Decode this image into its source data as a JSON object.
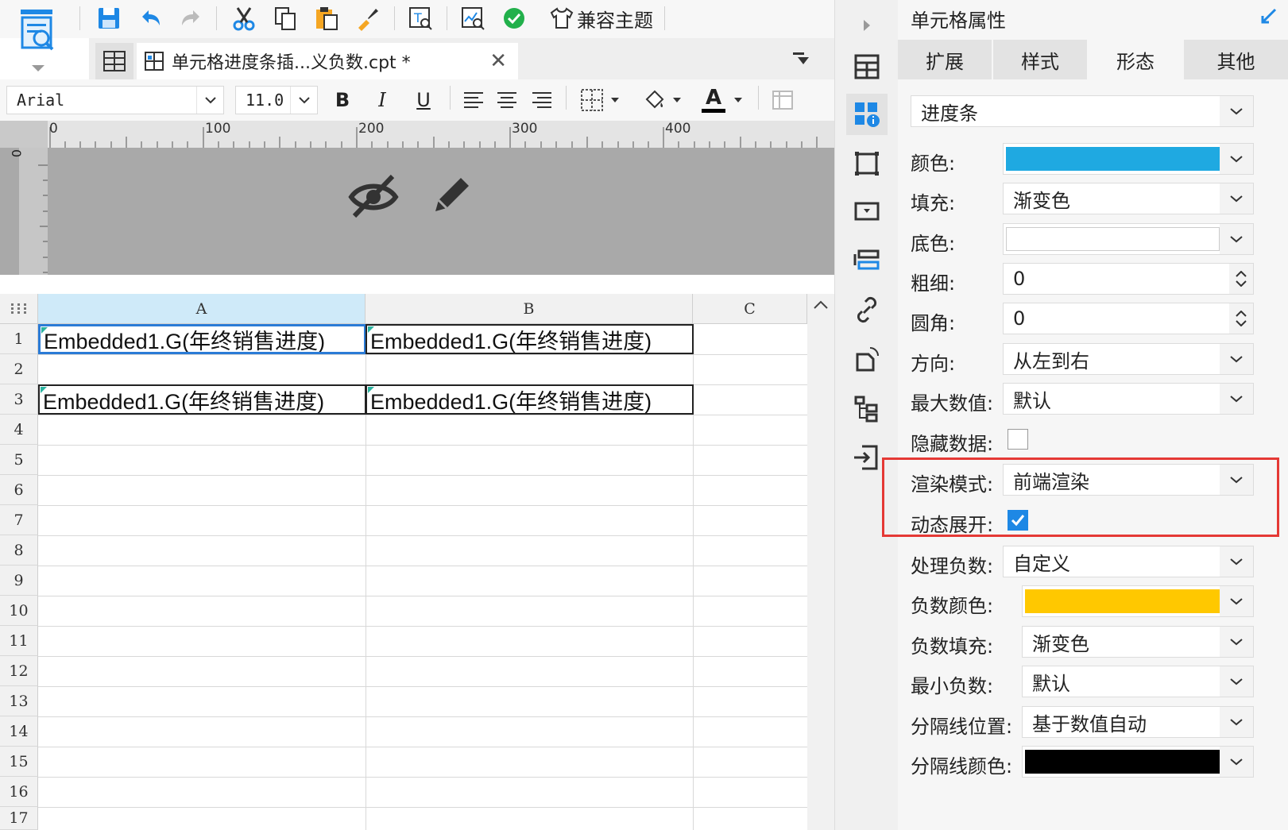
{
  "toolbar": {
    "compat_theme_label": "兼容主题"
  },
  "tabbar": {
    "doc_tab_title": "单元格进度条插...义负数.cpt *",
    "close_glyph": "✕"
  },
  "formatbar": {
    "font_name": "Arial",
    "font_size": "11.0",
    "bold": "B",
    "italic": "I",
    "underline": "U",
    "font_color_glyph": "A"
  },
  "ruler": {
    "h_labels": [
      "0",
      "100",
      "200",
      "300",
      "400"
    ],
    "v_zero": "0"
  },
  "grid": {
    "columns": [
      "A",
      "B",
      "C"
    ],
    "rows": [
      "1",
      "2",
      "3",
      "4",
      "5",
      "6",
      "7",
      "8",
      "9",
      "10",
      "11",
      "12",
      "13",
      "14",
      "15",
      "16",
      "17"
    ],
    "cells": {
      "A1": "Embedded1.G(年终销售进度)",
      "B1": "Embedded1.G(年终销售进度)",
      "A3": "Embedded1.G(年终销售进度)",
      "B3": "Embedded1.G(年终销售进度)"
    }
  },
  "panel": {
    "title": "单元格属性",
    "tabs": [
      "扩展",
      "样式",
      "形态",
      "其他"
    ],
    "active_tab": "形态",
    "type_value": "进度条",
    "props": {
      "color_label": "颜色:",
      "color_value": "#1fa9e1",
      "fill_label": "填充:",
      "fill_value": "渐变色",
      "bg_label": "底色:",
      "bg_value": "#ffffff",
      "thickness_label": "粗细:",
      "thickness_value": "0",
      "radius_label": "圆角:",
      "radius_value": "0",
      "direction_label": "方向:",
      "direction_value": "从左到右",
      "max_label": "最大数值:",
      "max_value": "默认",
      "hide_label": "隐藏数据:",
      "hide_checked": false,
      "render_label": "渲染模式:",
      "render_value": "前端渲染",
      "dynamic_label": "动态展开:",
      "dynamic_checked": true,
      "negative_label": "处理负数:",
      "negative_value": "自定义",
      "neg_color_label": "负数颜色:",
      "neg_color_value": "#ffc800",
      "neg_fill_label": "负数填充:",
      "neg_fill_value": "渐变色",
      "min_neg_label": "最小负数:",
      "min_neg_value": "默认",
      "divider_pos_label": "分隔线位置:",
      "divider_pos_value": "基于数值自动",
      "divider_color_label": "分隔线颜色:",
      "divider_color_value": "#000000"
    }
  },
  "colors": {
    "accent": "#2a7bd6",
    "highlight": "#e53935",
    "selected_col_header": "#cfeaf9"
  }
}
